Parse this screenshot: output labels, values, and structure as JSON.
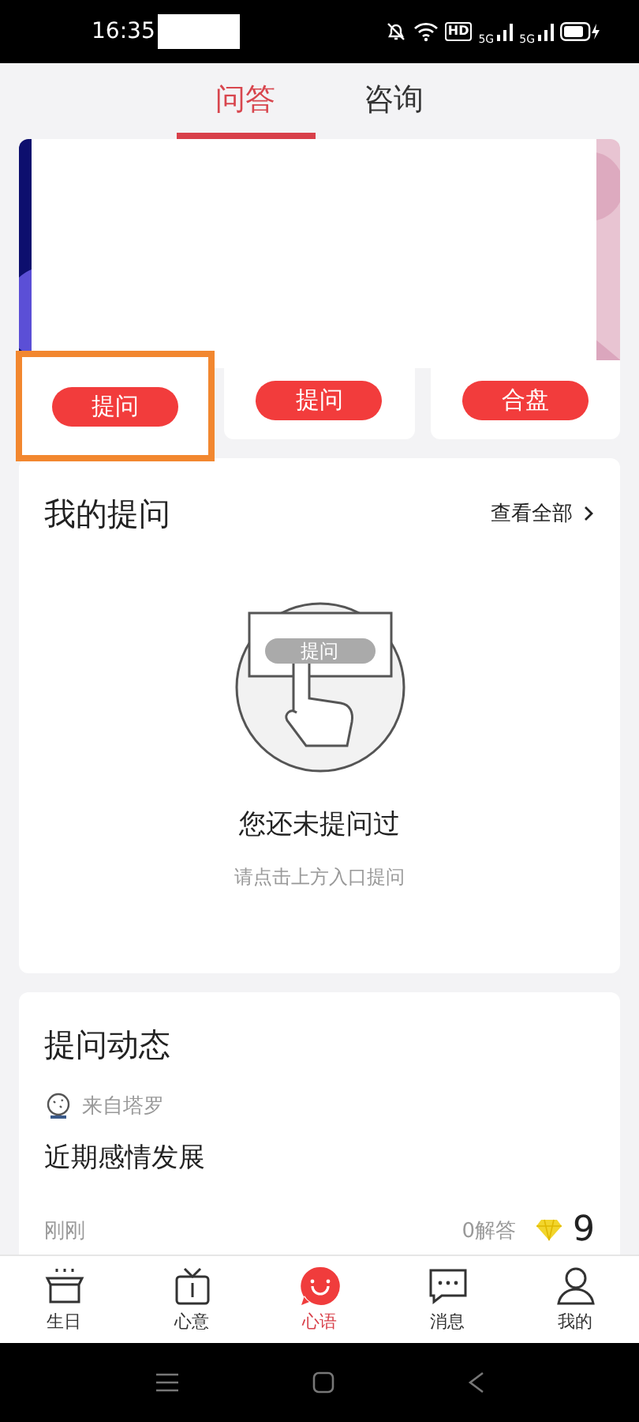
{
  "status_bar": {
    "time": "16:35",
    "network_badges": [
      "HD",
      "5G",
      "5G"
    ]
  },
  "tabs": [
    {
      "label": "问答",
      "selected": true
    },
    {
      "label": "咨询",
      "selected": false
    }
  ],
  "entry_cards": [
    {
      "button": "提问",
      "highlighted": true,
      "kind": "picture"
    },
    {
      "button": "提问",
      "highlighted": false,
      "kind": "plain"
    },
    {
      "button": "合盘",
      "highlighted": false,
      "kind": "picture"
    }
  ],
  "my_questions": {
    "title": "我的提问",
    "link": "查看全部",
    "illustration_button": "提问",
    "empty_title": "您还未提问过",
    "empty_hint": "请点击上方入口提问"
  },
  "question_feed": {
    "title": "提问动态",
    "items": [
      {
        "source": "来自塔罗",
        "question": "近期感情发展",
        "time": "刚刚",
        "answers": "0解答",
        "reward": "9"
      }
    ]
  },
  "bottom_nav": [
    {
      "label": "生日",
      "selected": false,
      "kind": "gift"
    },
    {
      "label": "心意",
      "selected": false,
      "kind": "tv"
    },
    {
      "label": "心语",
      "selected": true,
      "kind": "smile"
    },
    {
      "label": "消息",
      "selected": false,
      "kind": "chat"
    },
    {
      "label": "我的",
      "selected": false,
      "kind": "person"
    }
  ]
}
